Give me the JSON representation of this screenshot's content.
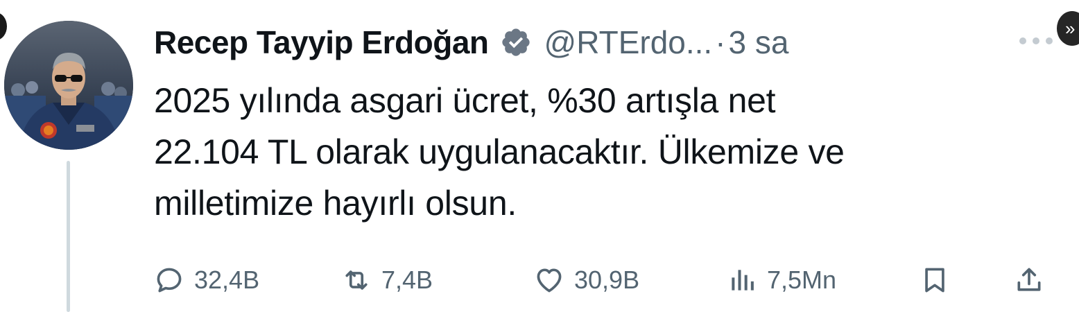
{
  "tweet": {
    "author": {
      "display_name": "Recep Tayyip Erdoğan",
      "handle": "@RTErdo...",
      "verified": true,
      "verified_icon": "verified-badge-icon",
      "avatar": "avatar-photo"
    },
    "separator": "·",
    "time": "3 sa",
    "more_icon": "more-horizontal-icon",
    "text_lines": [
      "2025 yılında asgari ücret, %30 artışla net",
      "22.104 TL olarak uygulanacaktır. Ülkemize ve",
      "milletimize hayırlı olsun."
    ],
    "actions": {
      "reply": {
        "icon": "reply-icon",
        "count": "32,4B"
      },
      "retweet": {
        "icon": "retweet-icon",
        "count": "7,4B"
      },
      "like": {
        "icon": "heart-icon",
        "count": "30,9B"
      },
      "views": {
        "icon": "views-icon",
        "count": "7,5Mn"
      },
      "bookmark": {
        "icon": "bookmark-icon"
      },
      "share": {
        "icon": "share-icon"
      }
    }
  },
  "colors": {
    "text_primary": "#0f1419",
    "text_secondary": "#536471",
    "thread_line": "#cfd9de",
    "background": "#ffffff"
  }
}
